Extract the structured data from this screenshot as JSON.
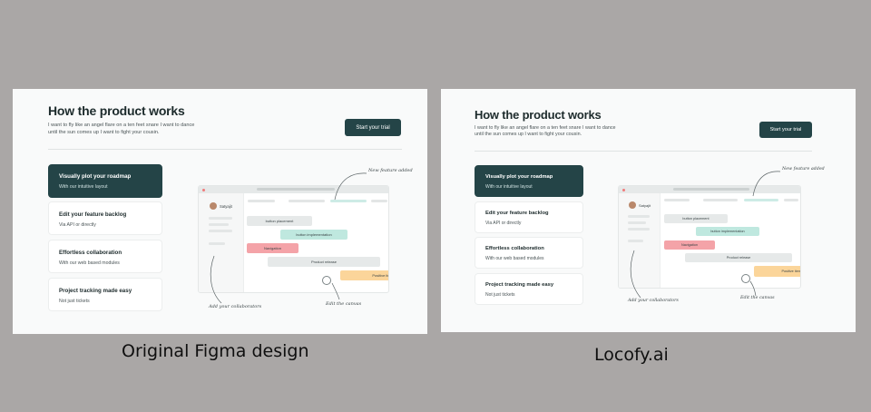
{
  "panels": {
    "original": {
      "title": "How the product works",
      "description": "I want to fly like an angel flare on a ten feet snare I want to dance\nuntil the sun comes up I want to fight your cousin.",
      "cta_label": "Start your trial",
      "cards": [
        {
          "title": "Visually plot your roadmap",
          "subtitle": "With our intuitive layout"
        },
        {
          "title": "Edit your feature backlog",
          "subtitle": "Via API or directly"
        },
        {
          "title": "Effortless collaboration",
          "subtitle": "With our web based modules"
        },
        {
          "title": "Project tracking made easy",
          "subtitle": "Not just tickets"
        }
      ],
      "mock": {
        "user_name": "Satyajit",
        "tasks": [
          "button placement",
          "button implementation",
          "Navigation",
          "Product release",
          "Positive item"
        ]
      },
      "annotations": {
        "new_feature": "New feature added",
        "collaborators": "Add your collaborators",
        "canvas": "Edit the canvas"
      }
    },
    "locofy": {
      "title": "How the product works",
      "description": "I want to fly like an angel flare on a ten feet snare I want to dance\nuntil the sun comes up I want to fight your cousin.",
      "cta_label": "Start your trial",
      "cards": [
        {
          "title": "Visually plot your roadmap",
          "subtitle": "With our intuitive layout"
        },
        {
          "title": "Edit your feature backlog",
          "subtitle": "Via API or directly"
        },
        {
          "title": "Effortless collaboration",
          "subtitle": "With our web based modules"
        },
        {
          "title": "Project tracking made easy",
          "subtitle": "Not just tickets"
        }
      ],
      "mock": {
        "user_name": "Satyajit",
        "tasks": [
          "button placement",
          "button implementation",
          "Navigation",
          "Product release",
          "Positive item"
        ]
      },
      "annotations": {
        "new_feature": "New feature added",
        "collaborators": "Add your collaborators",
        "canvas": "Edit the canvas"
      }
    }
  },
  "captions": {
    "original": "Original Figma design",
    "locofy": "Locofy.ai"
  },
  "colors": {
    "background": "#aaa7a6",
    "panel": "#f9fafa",
    "accent": "#244447"
  }
}
